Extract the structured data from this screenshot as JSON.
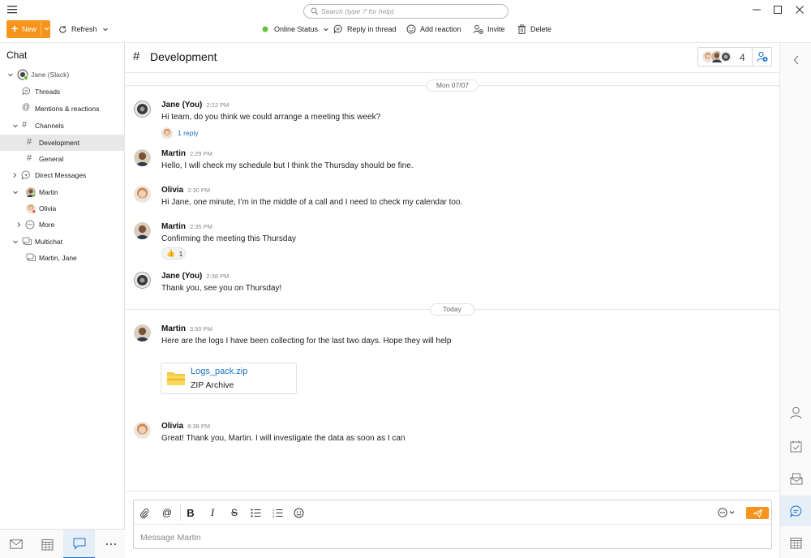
{
  "titlebar": {
    "search_placeholder": "Search (type '/' for help)"
  },
  "toolbar": {
    "new_label": "New",
    "refresh_label": "Refresh",
    "online_status_label": "Online Status",
    "reply_in_thread_label": "Reply in thread",
    "add_reaction_label": "Add reaction",
    "invite_label": "Invite",
    "delete_label": "Delete",
    "status_color": "#6cbf3c",
    "accent": "#f7941d"
  },
  "sidebar": {
    "heading": "Chat",
    "account": "Jane (Slack)",
    "items": [
      {
        "label": "Threads",
        "icon": "threads-icon"
      },
      {
        "label": "Mentions & reactions",
        "icon": "at-icon"
      },
      {
        "label": "Channels",
        "icon": "hash-icon"
      },
      {
        "label": "Development",
        "icon": "hash-icon",
        "selected": true
      },
      {
        "label": "General",
        "icon": "hash-icon"
      },
      {
        "label": "Direct Messages",
        "icon": "direct-messages-icon"
      },
      {
        "label": "Martin",
        "icon": "avatar"
      },
      {
        "label": "Olivia",
        "icon": "avatar"
      },
      {
        "label": "More",
        "icon": "more-icon"
      },
      {
        "label": "Multichat",
        "icon": "multichat-icon"
      },
      {
        "label": "Martin, Jane",
        "icon": "multichat-icon"
      }
    ]
  },
  "channel": {
    "hash": "#",
    "name": "Development",
    "member_count": "4"
  },
  "dates": {
    "first": "Mon 07/07",
    "second": "Today"
  },
  "messages": [
    {
      "author": "Jane (You)",
      "time": "2:22 PM",
      "text": "Hi team, do you think we could arrange a meeting this week?",
      "reply": "1 reply"
    },
    {
      "author": "Martin",
      "time": "2:29 PM",
      "text": "Hello, I will check my schedule but I think the Thursday should be fine."
    },
    {
      "author": "Olivia",
      "time": "2:30 PM",
      "text": "Hi Jane, one minute, I’m in the middle of a call and I need to check my calendar too."
    },
    {
      "author": "Martin",
      "time": "2:35 PM",
      "text": "Confirming the meeting this Thursday",
      "reaction": {
        "emoji": "👍",
        "count": "1"
      }
    },
    {
      "author": "Jane (You)",
      "time": "2:38 PM",
      "text": "Thank you, see you on Thursday!"
    },
    {
      "author": "Martin",
      "time": "3:50 PM",
      "text": "Here are the logs I have been collecting for the last two days. Hope they will help",
      "file": {
        "name": "Logs_pack.zip",
        "type": "ZIP Archive"
      }
    },
    {
      "author": "Olivia",
      "time": "8:38 PM",
      "text": "Great! Thank you, Martin. I will investigate the data as soon as I can"
    }
  ],
  "composer": {
    "placeholder": "Message Martin"
  },
  "colors": {
    "link": "#1a73c9",
    "selected_bg": "#e8e8e8"
  }
}
